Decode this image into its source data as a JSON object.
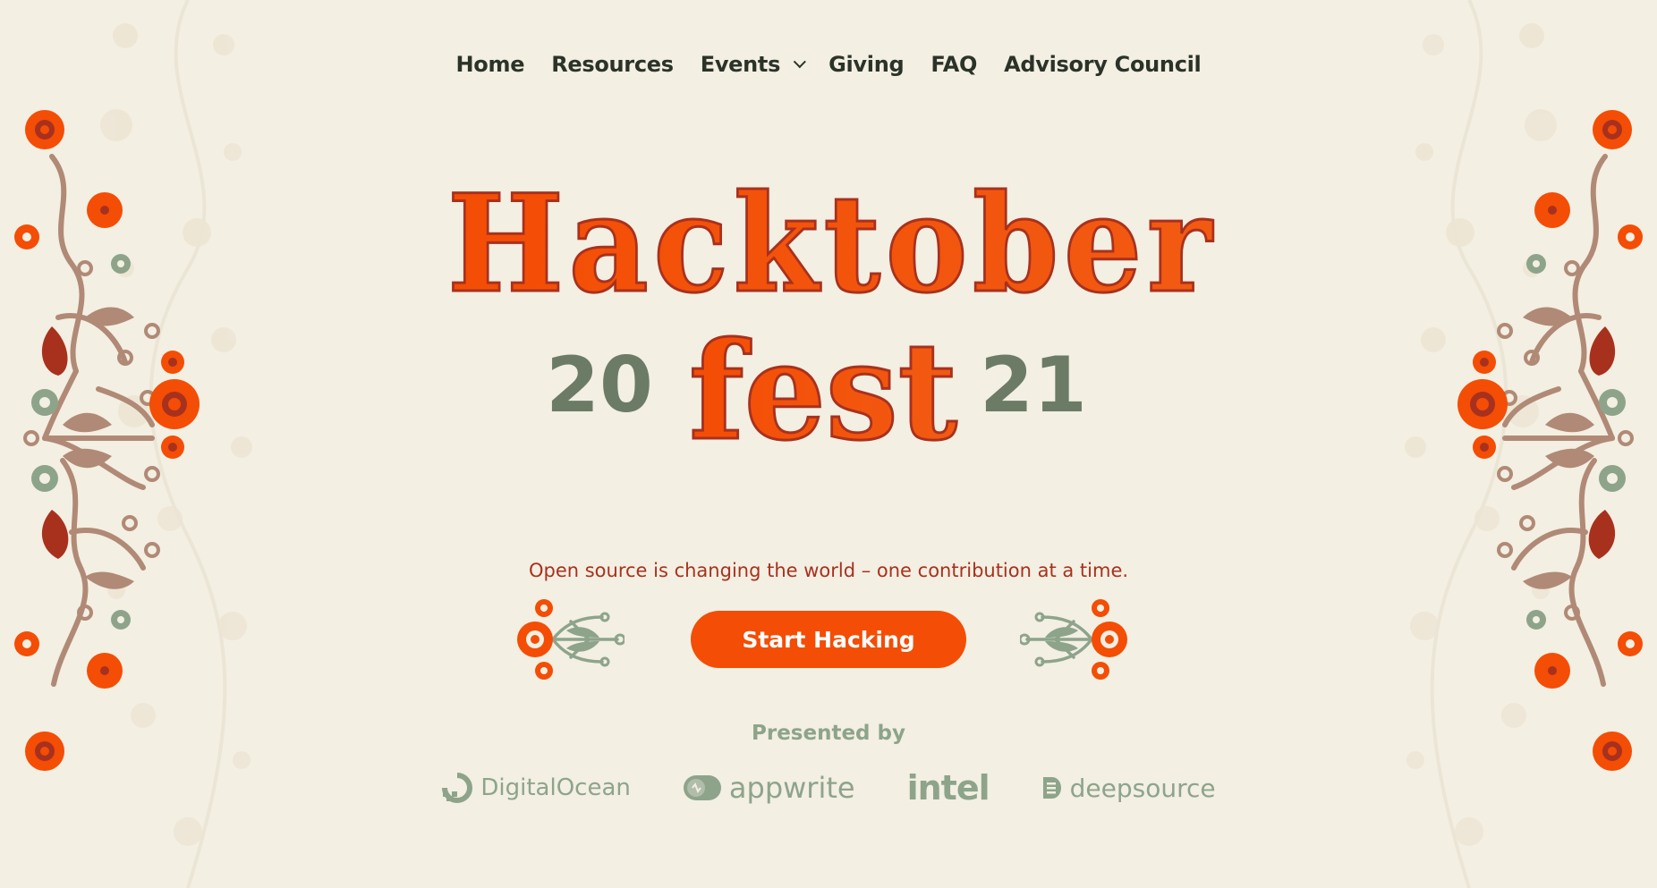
{
  "nav": {
    "items": [
      {
        "label": "Home"
      },
      {
        "label": "Resources"
      },
      {
        "label": "Events",
        "has_dropdown": true
      },
      {
        "label": "Giving"
      },
      {
        "label": "FAQ"
      },
      {
        "label": "Advisory Council"
      }
    ]
  },
  "logo": {
    "line1": "Hacktober",
    "line2": "fest",
    "year_left": "20",
    "year_right": "21"
  },
  "hero": {
    "tagline": "Open source is changing the world – one contribution at a time.",
    "cta_label": "Start Hacking"
  },
  "sponsors": {
    "heading": "Presented by",
    "items": [
      {
        "name": "DigitalOcean",
        "icon": "digitalocean-logo-icon"
      },
      {
        "name": "appwrite",
        "icon": "appwrite-logo-icon"
      },
      {
        "name": "intel",
        "icon": ""
      },
      {
        "name": "deepsource",
        "icon": "deepsource-logo-icon"
      }
    ]
  },
  "colors": {
    "background": "#f3efe2",
    "accent_orange": "#f44d05",
    "dark_red": "#a8311e",
    "sage": "#8da48b",
    "dark_text": "#2b3329",
    "gray_green": "#6b7b66"
  }
}
